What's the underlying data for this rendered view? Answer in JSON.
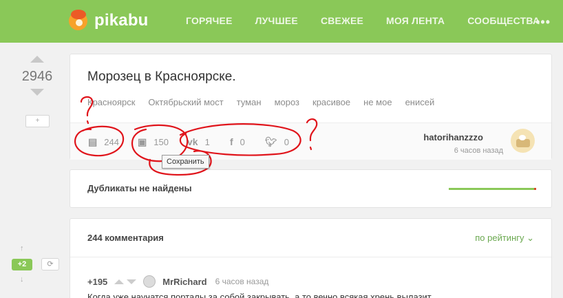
{
  "header": {
    "logo_text": "pikabu",
    "nav": [
      "ГОРЯЧЕЕ",
      "ЛУЧШЕЕ",
      "СВЕЖЕЕ",
      "МОЯ ЛЕНТА",
      "СООБЩЕСТВА"
    ],
    "more_icon": "more-icon",
    "brand_color": "#8ac858"
  },
  "sidebar": {
    "rating": "2946",
    "save_symbol": "+",
    "mini_badge": "+2"
  },
  "story": {
    "title": "Морозец в Красноярске.",
    "tags": [
      "Красноярск",
      "Октябрьский мост",
      "туман",
      "мороз",
      "красивое",
      "не мое",
      "енисей"
    ],
    "comments_count": "244",
    "saves_count": "150",
    "vk_count": "1",
    "fb_count": "0",
    "tw_count": "0",
    "tooltip": "Сохранить",
    "author": "hatorihanzzzo",
    "time": "6 часов назад"
  },
  "duplicates": {
    "label": "Дубликаты не найдены"
  },
  "comments": {
    "count_label": "244 комментария",
    "sort_label": "по рейтингу ⌄",
    "first": {
      "rating": "+195",
      "author": "MrRichard",
      "time": "6 часов назад",
      "text": "Когда уже научатся порталы за собой закрывать, а то вечно всякая хрень вылазит"
    }
  },
  "annotation_color": "#e0141b"
}
